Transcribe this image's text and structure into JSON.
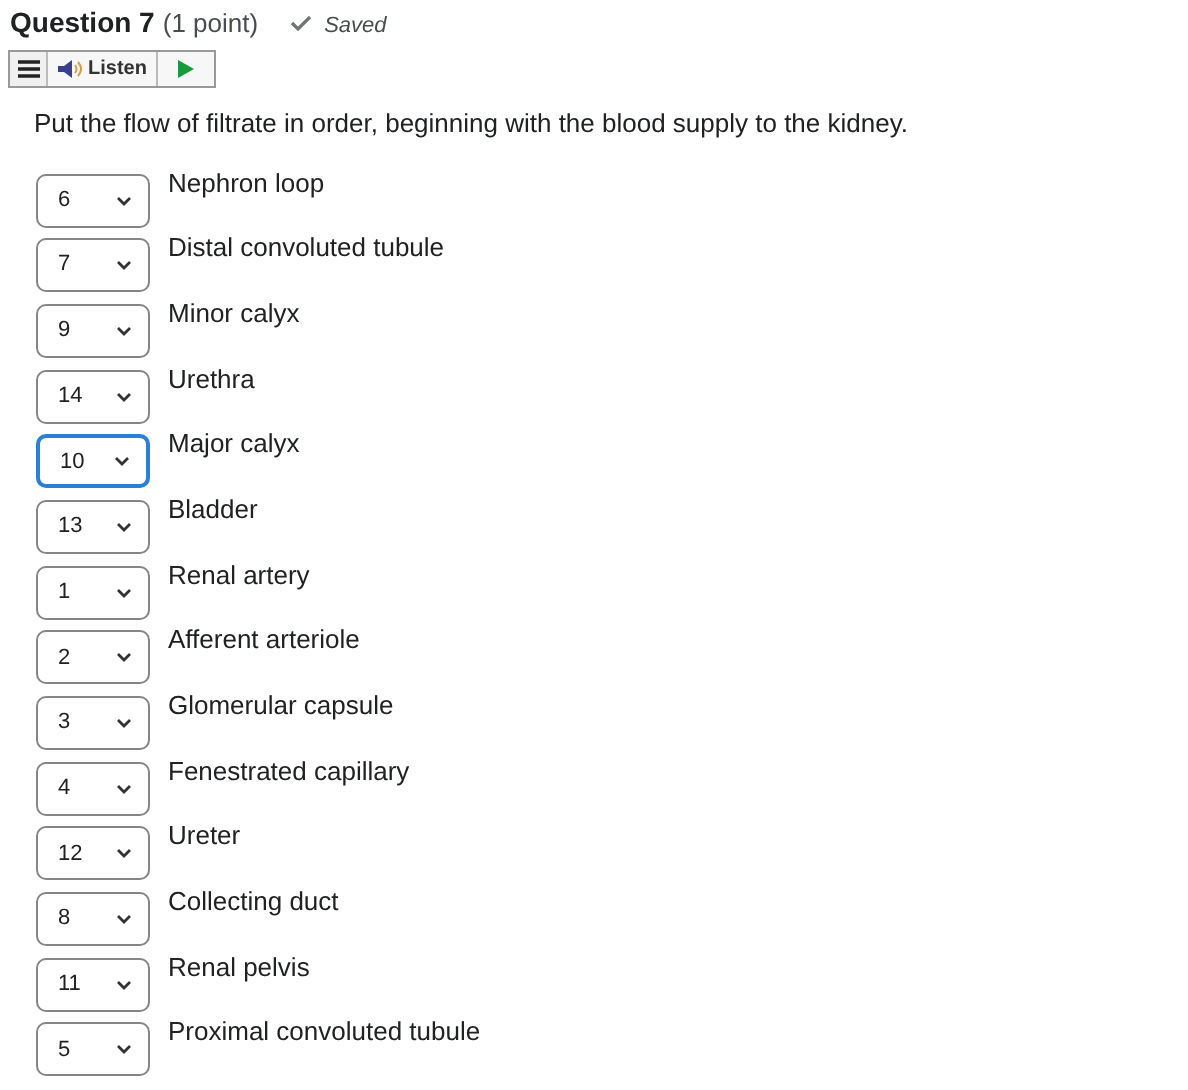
{
  "question": {
    "title": "Question 7",
    "points": "(1 point)",
    "status": "Saved"
  },
  "toolbar": {
    "listen": "Listen"
  },
  "prompt": "Put the flow of filtrate in order, beginning with the blood supply to the kidney.",
  "items": [
    {
      "value": "6",
      "label": "Nephron loop",
      "focused": false
    },
    {
      "value": "7",
      "label": "Distal convoluted tubule",
      "focused": false
    },
    {
      "value": "9",
      "label": "Minor calyx",
      "focused": false
    },
    {
      "value": "14",
      "label": "Urethra",
      "focused": false
    },
    {
      "value": "10",
      "label": "Major calyx",
      "focused": true
    },
    {
      "value": "13",
      "label": "Bladder",
      "focused": false
    },
    {
      "value": "1",
      "label": "Renal artery",
      "focused": false
    },
    {
      "value": "2",
      "label": "Afferent arteriole",
      "focused": false
    },
    {
      "value": "3",
      "label": "Glomerular capsule",
      "focused": false
    },
    {
      "value": "4",
      "label": "Fenestrated capillary",
      "focused": false
    },
    {
      "value": "12",
      "label": "Ureter",
      "focused": false
    },
    {
      "value": "8",
      "label": "Collecting duct",
      "focused": false
    },
    {
      "value": "11",
      "label": "Renal pelvis",
      "focused": false
    },
    {
      "value": "5",
      "label": "Proximal convoluted tubule",
      "focused": false
    }
  ]
}
